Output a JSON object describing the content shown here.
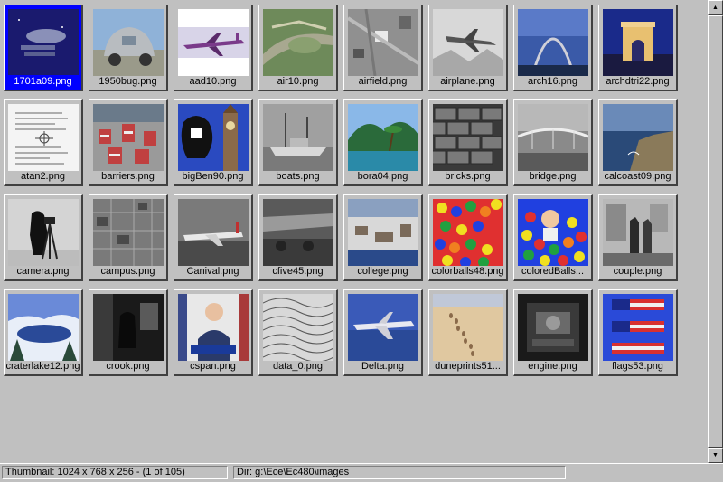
{
  "gallery": {
    "items": [
      {
        "label": "1701a09.png",
        "icon": "starship-thumbnail",
        "selected": true
      },
      {
        "label": "1950bug.png",
        "icon": "vw-beetle-thumbnail"
      },
      {
        "label": "aad10.png",
        "icon": "airliner-thumbnail"
      },
      {
        "label": "air10.png",
        "icon": "aerial-photo-thumbnail"
      },
      {
        "label": "airfield.png",
        "icon": "airfield-aerial-thumbnail"
      },
      {
        "label": "airplane.png",
        "icon": "jet-fighter-thumbnail"
      },
      {
        "label": "arch16.png",
        "icon": "gateway-arch-thumbnail"
      },
      {
        "label": "archdtri22.png",
        "icon": "arc-de-triomphe-thumbnail"
      },
      {
        "label": "atan2.png",
        "icon": "document-page-thumbnail"
      },
      {
        "label": "barriers.png",
        "icon": "barriers-thumbnail"
      },
      {
        "label": "bigBen90.png",
        "icon": "big-ben-thumbnail"
      },
      {
        "label": "boats.png",
        "icon": "boats-thumbnail"
      },
      {
        "label": "bora04.png",
        "icon": "tropical-island-thumbnail"
      },
      {
        "label": "bricks.png",
        "icon": "brick-wall-thumbnail"
      },
      {
        "label": "bridge.png",
        "icon": "bridge-thumbnail"
      },
      {
        "label": "calcoast09.png",
        "icon": "coastline-thumbnail"
      },
      {
        "label": "camera.png",
        "icon": "cameraman-thumbnail"
      },
      {
        "label": "campus.png",
        "icon": "campus-aerial-thumbnail"
      },
      {
        "label": "Canival.png",
        "icon": "airliner-runway-thumbnail"
      },
      {
        "label": "cfive45.png",
        "icon": "cargo-plane-thumbnail"
      },
      {
        "label": "college.png",
        "icon": "college-aerial-thumbnail"
      },
      {
        "label": "colorballs48.png",
        "icon": "ball-pit-thumbnail"
      },
      {
        "label": "coloredBalls...",
        "icon": "child-ball-pit-thumbnail"
      },
      {
        "label": "couple.png",
        "icon": "couple-room-thumbnail"
      },
      {
        "label": "craterlake12.png",
        "icon": "crater-lake-thumbnail"
      },
      {
        "label": "crook.png",
        "icon": "dark-scene-thumbnail"
      },
      {
        "label": "cspan.png",
        "icon": "speaker-podium-thumbnail"
      },
      {
        "label": "data_0.png",
        "icon": "texture-pattern-thumbnail"
      },
      {
        "label": "Delta.png",
        "icon": "delta-jet-thumbnail"
      },
      {
        "label": "duneprints51...",
        "icon": "sand-dune-footprints-thumbnail"
      },
      {
        "label": "engine.png",
        "icon": "car-engine-thumbnail"
      },
      {
        "label": "flags53.png",
        "icon": "american-flags-thumbnail"
      }
    ]
  },
  "status": {
    "thumbnail": "Thumbnail: 1024 x 768 x 256 - (1 of 105)",
    "dir": "Dir: g:\\Ece\\Ec480\\images"
  },
  "scrollbar": {
    "up": "▲",
    "down": "▼"
  },
  "colors": {
    "face": "#c0c0c0",
    "selection": "#0000ff"
  }
}
